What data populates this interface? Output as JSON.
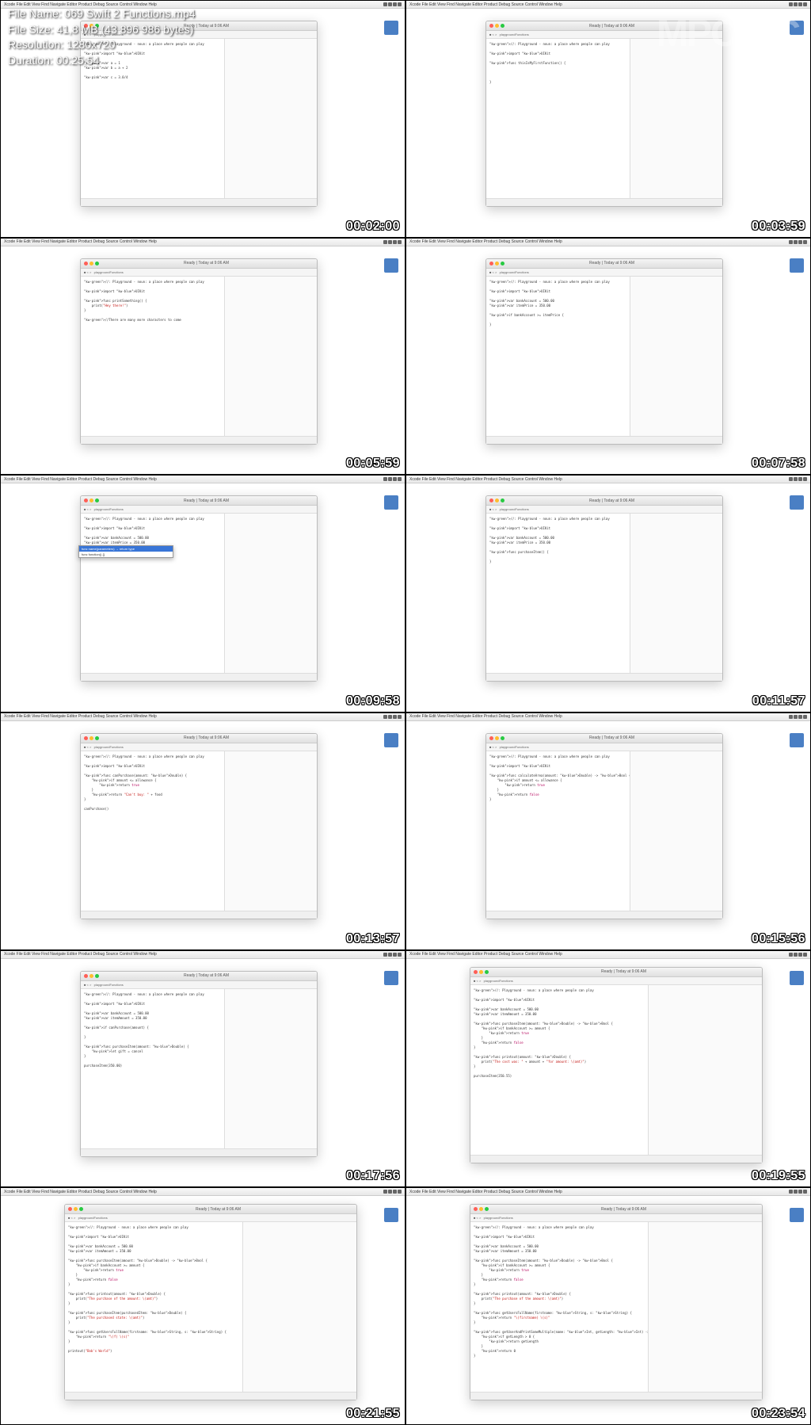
{
  "header": {
    "filename": "File Name: 069 Swift 2 Functions.mp4",
    "filesize": "File Size: 41,8 MB (43 896 986 bytes)",
    "resolution": "Resolution: 1280x720",
    "duration": "Duration: 00:25:54"
  },
  "logo": "MPC-HC",
  "menubar_items": "Xcode   File   Edit   View   Find   Navigate   Editor   Product   Debug   Source Control   Window   Help",
  "xcode_title": "Ready | Today at 9:06 AM",
  "playground_name": "playgroundFunctions",
  "thumbs": [
    {
      "timestamp": "00:02:00",
      "size": "small",
      "code": "//: Playground - noun: a place where people can play\n\nimport UIKit\n\nvar a = 1\nvar b = a + 2\n\nvar c = 3.0/4\n"
    },
    {
      "timestamp": "00:03:59",
      "size": "small",
      "code": "//: Playground - noun: a place where people can play\n\nimport UIKit\n\nfunc thisIsMyFirstFunction() {\n\n\n\n}\n"
    },
    {
      "timestamp": "00:05:59",
      "size": "small",
      "code": "//: Playground - noun: a place where people can play\n\nimport UIKit\n\nfunc printSomething() {\n    print(\"Hey there!\")\n}\n\n//There are many more characters to come\n"
    },
    {
      "timestamp": "00:07:58",
      "size": "small",
      "code": "//: Playground - noun: a place where people can play\n\nimport UIKit\n\nvar bankAccount = 500.00\nvar itemPrice = 350.00\n\nif bankAccount >= itemPrice {\n\n}\n"
    },
    {
      "timestamp": "00:09:58",
      "size": "small",
      "autocomplete": true,
      "code": "//: Playground - noun: a place where people can play\n\nimport UIKit\n\nvar bankAccount = 500.00\nvar itemPrice = 350.00\n\nfunc"
    },
    {
      "timestamp": "00:11:57",
      "size": "small",
      "code": "//: Playground - noun: a place where people can play\n\nimport UIKit\n\nvar bankAccount = 500.00\nvar itemPrice = 350.00\n\nfunc purchaseItem() {\n\n}\n"
    },
    {
      "timestamp": "00:13:57",
      "size": "small",
      "code": "//: Playground - noun: a place where people can play\n\nimport UIKit\n\nfunc canPurchase(amount: Double) {\n    if amount <= allowance {\n        return true\n    }\n    return \"Can't buy: \" + food\n}\n\ncanPurchase(<amount>)\n"
    },
    {
      "timestamp": "00:15:56",
      "size": "small",
      "code": "//: Playground - noun: a place where people can play\n\nimport UIKit\n\nfunc calculateArea(amount: Double) -> Bool {\n    if amount <= allowance {\n        return true\n    }\n    return false\n}\n"
    },
    {
      "timestamp": "00:17:56",
      "size": "small",
      "code": "//: Playground - noun: a place where people can play\n\nimport UIKit\n\nvar bankAccount = 500.00\nvar itemAmount = 350.00\n\nif canPurchase(amount) {\n\n}\n\nfunc purchaseItem(amount: Double) {\n    let gift = cancel\n}\n\npurchaseItem(350.00)\n"
    },
    {
      "timestamp": "00:19:55",
      "size": "large",
      "code": "//: Playground - noun: a place where people can play\n\nimport UIKit\n\nvar bankAccount = 500.00\nvar itemAmount = 350.00\n\nfunc purchaseItem(amount: Double) -> Bool {\n    if bankAccount >= amount {\n        return true\n    }\n    return false\n}\n\nfunc printout(amount: Double) {\n    print(\"The cost was: \" + amount + \"for amount: \\(amt)\")\n}\n\npurchaseItem(350.55)\n"
    },
    {
      "timestamp": "00:21:55",
      "size": "large",
      "code": "//: Playground - noun: a place where people can play\n\nimport UIKit\n\nvar bankAccount = 500.00\nvar itemAmount = 350.00\n\nfunc purchaseItem(amount: Double) -> Bool {\n    if bankAccount >= amount {\n        return true\n    }\n    return false\n}\n\nfunc printout(amount: Double) {\n    print(\"The purchase of the amount: \\(amt)\")\n}\n\nfunc purchaseItem(purchasedItem: Double) {\n    print(\"The purchased state: \\(amt)\")\n}\n\nfunc getUsersFullName(firstname: String, s: String) {\n    return \"\\(f) \\(s)\"\n}\n\nprintout(\"Bob's World\")\n"
    },
    {
      "timestamp": "00:23:54",
      "size": "large",
      "code": "//: Playground - noun: a place where people can play\n\nimport UIKit\n\nvar bankAccount = 500.00\nvar itemAmount = 350.00\n\nfunc purchaseItem(amount: Double) -> Bool {\n    if bankAccount >= amount {\n        return true\n    }\n    return false\n}\n\nfunc printout(amount: Double) {\n    print(\"The purchase of the amount: \\(amt)\")\n}\n\nfunc getUsersFullName(firstname: String, s: String) {\n    return \"\\(firstname) \\(s)\"\n}\n\nfunc getUserAndPrintSomeMultiple(name: Int, getLength: Int) -> Int {\n    if getLength > 0 {\n        return getLength\n    }\n    return 0\n}\n"
    }
  ]
}
